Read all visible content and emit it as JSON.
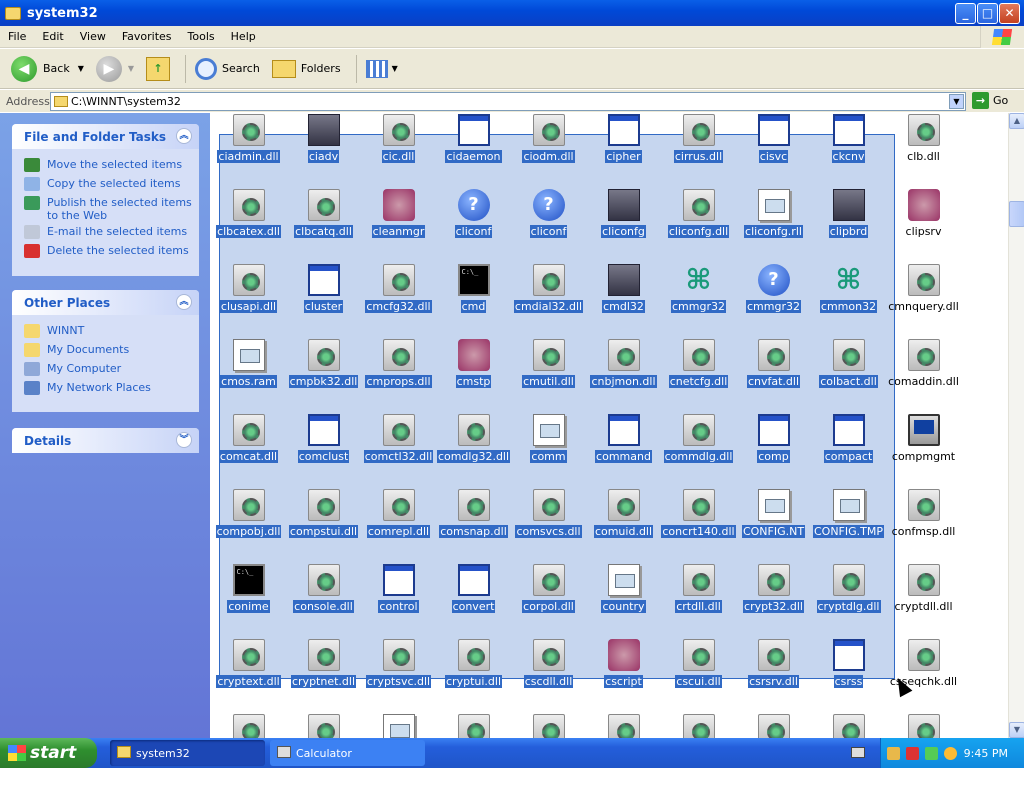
{
  "window": {
    "title": "system32",
    "buttons": {
      "minimize": "_",
      "maximize": "□",
      "close": "✕"
    }
  },
  "menu": [
    "File",
    "Edit",
    "View",
    "Favorites",
    "Tools",
    "Help"
  ],
  "toolbar": {
    "back": "Back",
    "search": "Search",
    "folders": "Folders"
  },
  "address": {
    "label": "Address",
    "value": "C:\\WINNT\\system32",
    "go": "Go"
  },
  "tasks_panel": {
    "title": "File and Folder Tasks",
    "items": [
      {
        "label": "Move the selected items",
        "icon": "move-icon",
        "color": "#3a8a3a"
      },
      {
        "label": "Copy the selected items",
        "icon": "copy-icon",
        "color": "#8fb3e6"
      },
      {
        "label": "Publish the selected items to the Web",
        "icon": "globe-icon",
        "color": "#3a9a5a"
      },
      {
        "label": "E-mail the selected items",
        "icon": "email-icon",
        "color": "#c0c8d8"
      },
      {
        "label": "Delete the selected items",
        "icon": "delete-icon",
        "color": "#d83030"
      }
    ]
  },
  "places_panel": {
    "title": "Other Places",
    "items": [
      {
        "label": "WINNT",
        "icon": "folder-icon",
        "color": "#f5d76e"
      },
      {
        "label": "My Documents",
        "icon": "my-documents-icon",
        "color": "#f5d76e"
      },
      {
        "label": "My Computer",
        "icon": "my-computer-icon",
        "color": "#8fa8d8"
      },
      {
        "label": "My Network Places",
        "icon": "network-places-icon",
        "color": "#5a82c8"
      }
    ]
  },
  "details_panel": {
    "title": "Details"
  },
  "files": {
    "columns": 10,
    "selected_columns": 9,
    "rows": [
      [
        [
          "ciadmin.dll",
          "dll"
        ],
        [
          "ciadv",
          "net"
        ],
        [
          "cic.dll",
          "dll"
        ],
        [
          "cidaemon",
          "win"
        ],
        [
          "ciodm.dll",
          "dll"
        ],
        [
          "cipher",
          "win"
        ],
        [
          "cirrus.dll",
          "dll"
        ],
        [
          "cisvc",
          "win"
        ],
        [
          "ckcnv",
          "win"
        ],
        [
          "clb.dll",
          "dll"
        ]
      ],
      [
        [
          "clbcatex.dll",
          "dll"
        ],
        [
          "clbcatq.dll",
          "dll"
        ],
        [
          "cleanmgr",
          "misc"
        ],
        [
          "cliconf",
          "help"
        ],
        [
          "cliconf",
          "help"
        ],
        [
          "cliconfg",
          "net"
        ],
        [
          "cliconfg.dll",
          "dll"
        ],
        [
          "cliconfg.rll",
          "doc"
        ],
        [
          "clipbrd",
          "net"
        ],
        [
          "clipsrv",
          "misc"
        ]
      ],
      [
        [
          "clusapi.dll",
          "dll"
        ],
        [
          "cluster",
          "win"
        ],
        [
          "cmcfg32.dll",
          "dll"
        ],
        [
          "cmd",
          "cmd"
        ],
        [
          "cmdial32.dll",
          "dll"
        ],
        [
          "cmdl32",
          "net"
        ],
        [
          "cmmgr32",
          "cmm"
        ],
        [
          "cmmgr32",
          "help"
        ],
        [
          "cmmon32",
          "cmm"
        ],
        [
          "cmnquery.dll",
          "dll"
        ]
      ],
      [
        [
          "cmos.ram",
          "doc"
        ],
        [
          "cmpbk32.dll",
          "dll"
        ],
        [
          "cmprops.dll",
          "dll"
        ],
        [
          "cmstp",
          "misc"
        ],
        [
          "cmutil.dll",
          "dll"
        ],
        [
          "cnbjmon.dll",
          "dll"
        ],
        [
          "cnetcfg.dll",
          "dll"
        ],
        [
          "cnvfat.dll",
          "dll"
        ],
        [
          "colbact.dll",
          "dll"
        ],
        [
          "comaddin.dll",
          "dll"
        ]
      ],
      [
        [
          "comcat.dll",
          "dll"
        ],
        [
          "comclust",
          "win"
        ],
        [
          "comctl32.dll",
          "dll"
        ],
        [
          "comdlg32.dll",
          "dll"
        ],
        [
          "comm",
          "doc"
        ],
        [
          "command",
          "win"
        ],
        [
          "commdlg.dll",
          "dll"
        ],
        [
          "comp",
          "win"
        ],
        [
          "compact",
          "win"
        ],
        [
          "compmgmt",
          "pc"
        ]
      ],
      [
        [
          "compobj.dll",
          "dll"
        ],
        [
          "compstui.dll",
          "dll"
        ],
        [
          "comrepl.dll",
          "dll"
        ],
        [
          "comsnap.dll",
          "dll"
        ],
        [
          "comsvcs.dll",
          "dll"
        ],
        [
          "comuid.dll",
          "dll"
        ],
        [
          "concrt140.dll",
          "dll"
        ],
        [
          "CONFIG.NT",
          "doc"
        ],
        [
          "CONFIG.TMP",
          "doc"
        ],
        [
          "confmsp.dll",
          "dll"
        ]
      ],
      [
        [
          "conime",
          "cmd"
        ],
        [
          "console.dll",
          "dll"
        ],
        [
          "control",
          "win"
        ],
        [
          "convert",
          "win"
        ],
        [
          "corpol.dll",
          "dll"
        ],
        [
          "country",
          "doc"
        ],
        [
          "crtdll.dll",
          "dll"
        ],
        [
          "crypt32.dll",
          "dll"
        ],
        [
          "cryptdlg.dll",
          "dll"
        ],
        [
          "cryptdll.dll",
          "dll"
        ]
      ],
      [
        [
          "cryptext.dll",
          "dll"
        ],
        [
          "cryptnet.dll",
          "dll"
        ],
        [
          "cryptsvc.dll",
          "dll"
        ],
        [
          "cryptui.dll",
          "dll"
        ],
        [
          "cscdll.dll",
          "dll"
        ],
        [
          "cscript",
          "misc"
        ],
        [
          "cscui.dll",
          "dll"
        ],
        [
          "csrsrv.dll",
          "dll"
        ],
        [
          "csrss",
          "win"
        ],
        [
          "csseqchk.dll",
          "dll"
        ]
      ],
      [
        [
          "",
          "dll"
        ],
        [
          "",
          "dll"
        ],
        [
          "",
          "doc"
        ],
        [
          "",
          "dll"
        ],
        [
          "",
          "dll"
        ],
        [
          "",
          "dll"
        ],
        [
          "",
          "dll"
        ],
        [
          "",
          "dll"
        ],
        [
          "",
          "dll"
        ],
        [
          "",
          "dll"
        ]
      ]
    ]
  },
  "taskbar": {
    "start": "start",
    "tasks": [
      {
        "label": "system32",
        "active": true
      },
      {
        "label": "Calculator",
        "active": false
      }
    ],
    "clock": "9:45 PM"
  }
}
